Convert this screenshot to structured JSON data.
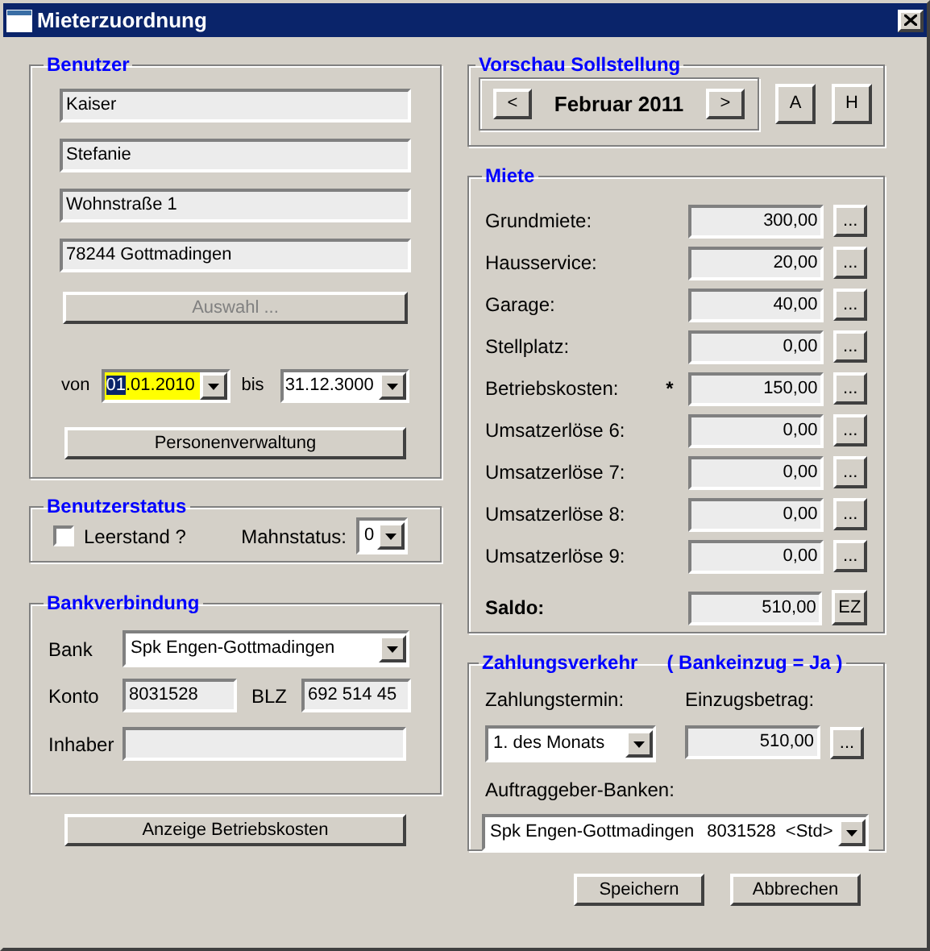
{
  "window": {
    "title": "Mieterzuordnung"
  },
  "benutzer": {
    "legend": "Benutzer",
    "fields": [
      "Kaiser",
      "Stefanie",
      "Wohnstraße 1",
      "78244 Gottmadingen"
    ],
    "auswahl_button": {
      "label": "Auswahl ...",
      "disabled": true
    },
    "von": {
      "label": "von",
      "value_selection": "01",
      "value_rest": ".01.2010",
      "focused": true
    },
    "bis": {
      "label": "bis",
      "value_rest": "31.12.3000",
      "focused": false
    },
    "personen_button": {
      "label": "Personenverwaltung"
    }
  },
  "benutzerstatus": {
    "legend": "Benutzerstatus",
    "leerstand": {
      "label": "Leerstand ?",
      "checked": false
    },
    "mahnstatus": {
      "label": "Mahnstatus:",
      "value": "0"
    }
  },
  "bankverbindung": {
    "legend": "Bankverbindung",
    "bank": {
      "label": "Bank",
      "value": "Spk Engen-Gottmadingen"
    },
    "konto": {
      "label": "Konto",
      "value": "8031528"
    },
    "blz": {
      "label": "BLZ",
      "value": "692 514 45"
    },
    "inhaber": {
      "label": "Inhaber"
    }
  },
  "betriebskosten_button": {
    "label": "Anzeige Betriebskosten"
  },
  "vorschau": {
    "legend": "Vorschau Sollstellung",
    "prev": "<",
    "month": "Februar 2011",
    "next": ">",
    "buttons": [
      "A",
      "H"
    ]
  },
  "miete": {
    "legend": "Miete",
    "rows": [
      {
        "kind": "item",
        "label": "Grundmiete:",
        "value": "300,00",
        "button": "..."
      },
      {
        "kind": "item",
        "label": "Hausservice:",
        "value": "20,00",
        "button": "..."
      },
      {
        "kind": "item",
        "label": "Garage:",
        "value": "40,00",
        "button": "..."
      },
      {
        "kind": "item",
        "label": "Stellplatz:",
        "value": "0,00",
        "button": "..."
      },
      {
        "kind": "item",
        "label": "Betriebskosten:",
        "marker": "*",
        "value": "150,00",
        "button": "..."
      },
      {
        "kind": "item",
        "label": "Umsatzerlöse 6:",
        "value": "0,00",
        "button": "..."
      },
      {
        "kind": "item",
        "label": "Umsatzerlöse 7:",
        "value": "0,00",
        "button": "..."
      },
      {
        "kind": "item",
        "label": "Umsatzerlöse 8:",
        "value": "0,00",
        "button": "..."
      },
      {
        "kind": "item",
        "label": "Umsatzerlöse 9:",
        "value": "0,00",
        "button": "..."
      },
      {
        "kind": "total",
        "label": "Saldo:",
        "value": "510,00",
        "button": "EZ"
      }
    ]
  },
  "zahlungsverkehr": {
    "legend": "Zahlungsverkehr",
    "legend_note": "( Bankeinzug = Ja )",
    "termin": {
      "label": "Zahlungstermin:",
      "value": "1. des Monats"
    },
    "einzug": {
      "label": "Einzugsbetrag:",
      "value": "510,00",
      "button": "..."
    },
    "banken": {
      "label": "Auftraggeber-Banken:",
      "bank": "Spk Engen-Gottmadingen",
      "konto": "8031528",
      "tag": "<Std>"
    }
  },
  "footer_buttons": [
    "Speichern",
    "Abbrechen"
  ]
}
